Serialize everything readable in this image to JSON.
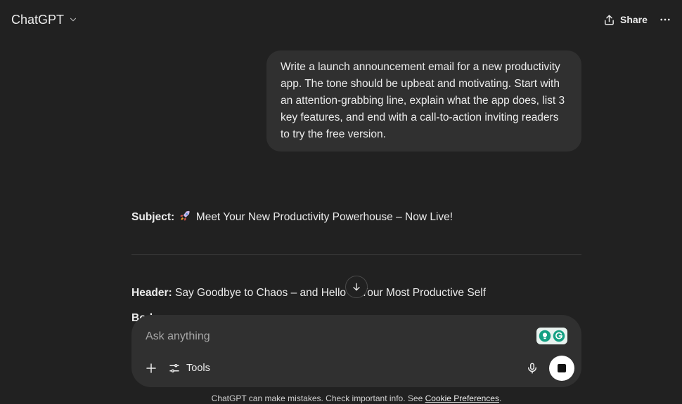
{
  "header": {
    "model_label": "ChatGPT",
    "share_label": "Share"
  },
  "conversation": {
    "user_message": "Write a launch announcement email for a new productivity app. The tone should be upbeat and motivating. Start with an attention-grabbing line, explain what the app does, list 3 key features, and end with a call-to-action inviting readers to try the free version.",
    "subject_label": "Subject:",
    "subject_text": "Meet Your New Productivity Powerhouse – Now Live!",
    "header_label": "Header:",
    "header_text": "Say Goodbye to Chaos – and Hello to Your Most Productive Self",
    "body_label": "Body:"
  },
  "composer": {
    "placeholder": "Ask anything",
    "tools_label": "Tools"
  },
  "footer": {
    "disclaimer": "ChatGPT can make mistakes. Check important info. See ",
    "link_label": "Cookie Preferences",
    "suffix": "."
  },
  "icons": {
    "model_dropdown": "chevron-down-icon",
    "share": "share-icon",
    "more": "more-horizontal-icon",
    "subject_emoji": "rocket-icon",
    "scroll_down": "arrow-down-icon",
    "plus": "plus-icon",
    "tools": "sliders-icon",
    "mic": "microphone-icon",
    "stop": "stop-icon",
    "grammarly": "grammarly-icon"
  }
}
